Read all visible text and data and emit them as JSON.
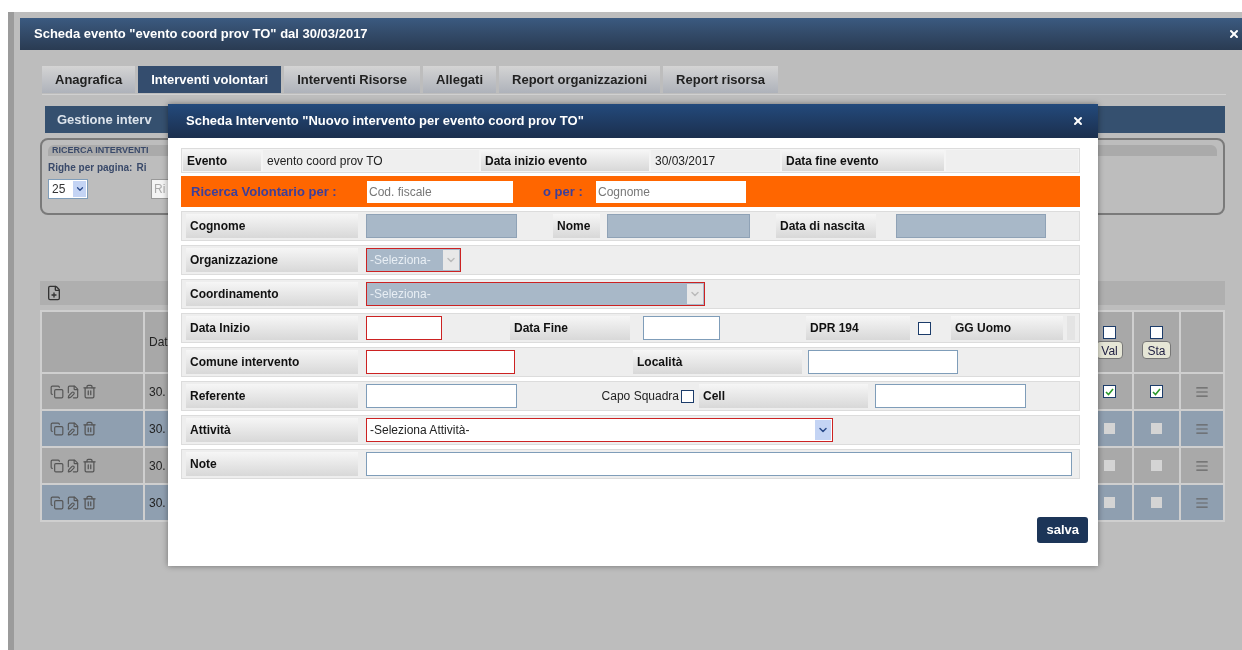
{
  "window": {
    "title": "Scheda evento \"evento coord prov TO\" dal 30/03/2017"
  },
  "tabs": [
    {
      "label": "Anagrafica",
      "selected": false
    },
    {
      "label": "Interventi volontari",
      "selected": true
    },
    {
      "label": "Interventi Risorse",
      "selected": false
    },
    {
      "label": "Allegati",
      "selected": false
    },
    {
      "label": "Report organizzazioni",
      "selected": false
    },
    {
      "label": "Report risorsa",
      "selected": false
    }
  ],
  "section_bar": {
    "title": "Gestione interv"
  },
  "search_panel": {
    "title": "RICERCA INTERVENTI",
    "rows_label": "Righe per pagina:",
    "column_2_label": "Ri",
    "page_size": "25",
    "field_placeholder": "Ri"
  },
  "table": {
    "column_2": "Dat",
    "flag_columns": [
      {
        "label": "Val",
        "checked": false
      },
      {
        "label": "Sta",
        "checked": false
      }
    ],
    "rows": [
      {
        "column_2": "30.",
        "enabled": true,
        "flags": [
          true,
          true
        ]
      },
      {
        "column_2": "30.",
        "enabled": false,
        "flags": [
          false,
          false
        ]
      },
      {
        "column_2": "30.",
        "enabled": false,
        "flags": [
          false,
          false
        ]
      },
      {
        "column_2": "30.",
        "enabled": false,
        "flags": [
          false,
          false
        ]
      }
    ]
  },
  "modal": {
    "title": "Scheda Intervento \"Nuovo intervento per evento coord prov TO\"",
    "event_row": [
      {
        "kind": "label",
        "text": "Evento"
      },
      {
        "kind": "text",
        "text": "evento coord prov TO"
      },
      {
        "kind": "label",
        "text": "Data inizio evento"
      },
      {
        "kind": "text",
        "text": "30/03/2017"
      },
      {
        "kind": "label",
        "text": "Data fine evento"
      }
    ],
    "search_row": {
      "label": "Ricerca Volontario per :",
      "fiscal_placeholder": "Cod. fiscale",
      "or_label": "o per :",
      "surname_placeholder": "Cognome"
    },
    "rows": [
      [
        {
          "kind": "label",
          "text": "Cognome"
        },
        {
          "kind": "input",
          "disabled": true,
          "required": false
        },
        {
          "kind": "label",
          "text": "Nome"
        },
        {
          "kind": "input",
          "disabled": true,
          "required": false
        },
        {
          "kind": "label",
          "text": "Data di nascita"
        },
        {
          "kind": "input",
          "disabled": true,
          "required": false
        }
      ],
      [
        {
          "kind": "label",
          "text": "Organizzazione"
        },
        {
          "kind": "select",
          "value": "-Seleziona-",
          "disabled": true,
          "required": true
        }
      ],
      [
        {
          "kind": "label",
          "text": "Coordinamento"
        },
        {
          "kind": "select",
          "value": "-Seleziona-",
          "disabled": true,
          "required": true
        }
      ],
      [
        {
          "kind": "label",
          "text": "Data Inizio"
        },
        {
          "kind": "input",
          "disabled": false,
          "required": true
        },
        {
          "kind": "label",
          "text": "Data Fine"
        },
        {
          "kind": "input",
          "disabled": false,
          "required": false
        },
        {
          "kind": "label",
          "text": "DPR 194"
        },
        {
          "kind": "checkbox",
          "checked": false
        },
        {
          "kind": "label",
          "text": "GG Uomo"
        }
      ],
      [
        {
          "kind": "label",
          "text": "Comune intervento"
        },
        {
          "kind": "input",
          "disabled": false,
          "required": true
        },
        {
          "kind": "label",
          "text": "Località"
        },
        {
          "kind": "input",
          "disabled": false,
          "required": false
        }
      ],
      [
        {
          "kind": "label",
          "text": "Referente"
        },
        {
          "kind": "input",
          "disabled": false,
          "required": false
        },
        {
          "kind": "plain",
          "text": "Capo Squadra"
        },
        {
          "kind": "checkbox",
          "checked": false
        },
        {
          "kind": "label",
          "text": "Cell"
        },
        {
          "kind": "input",
          "disabled": false,
          "required": false
        }
      ],
      [
        {
          "kind": "label",
          "text": "Attività"
        },
        {
          "kind": "select",
          "value": "-Seleziona Attività-",
          "disabled": false,
          "required": true
        }
      ],
      [
        {
          "kind": "label",
          "text": "Note"
        },
        {
          "kind": "input",
          "disabled": false,
          "required": false
        }
      ]
    ],
    "save_button": "salva"
  }
}
